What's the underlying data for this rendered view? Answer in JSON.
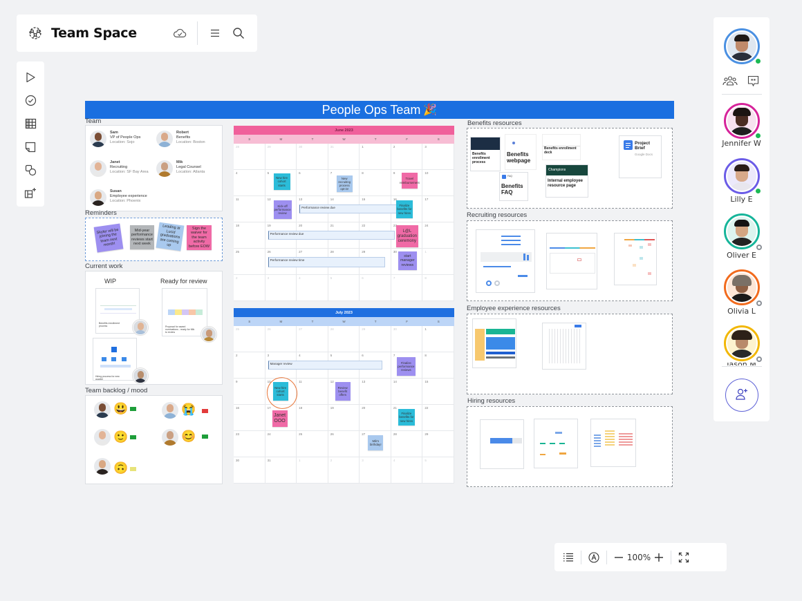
{
  "topbar": {
    "space_icon": "team-space-icon",
    "title": "Team Space",
    "icons": [
      "cloud-saved-icon",
      "menu-icon",
      "search-icon"
    ]
  },
  "left_toolbar": {
    "tools": [
      {
        "name": "select-tool",
        "icon": "cursor-icon"
      },
      {
        "name": "task-tool",
        "icon": "check-circle-icon"
      },
      {
        "name": "table-tool",
        "icon": "table-icon"
      },
      {
        "name": "sticky-note-tool",
        "icon": "sticky-note-icon"
      },
      {
        "name": "shapes-tool",
        "icon": "shapes-icon"
      },
      {
        "name": "add-template-tool",
        "icon": "add-frame-icon"
      }
    ]
  },
  "collaborators": {
    "current_user": {
      "ring_color": "#4a90e2",
      "status": "online"
    },
    "icons": [
      "team-icon",
      "comments-icon"
    ],
    "people": [
      {
        "name": "Jennifer W",
        "ring_color": "#d6239a",
        "status": "online"
      },
      {
        "name": "Lilly E",
        "ring_color": "#6b5ce7",
        "status": "online"
      },
      {
        "name": "Oliver E",
        "ring_color": "#16b59a",
        "status": "away"
      },
      {
        "name": "Olivia L",
        "ring_color": "#f26b1d",
        "status": "away"
      },
      {
        "name": "Jason M",
        "ring_color": "#f2b705",
        "status": "away"
      }
    ],
    "add_user_icon": "add-user-icon"
  },
  "zoom_bar": {
    "zoom_level": "100%",
    "icons": [
      "outline-icon",
      "accessibility-icon",
      "zoom-out-icon",
      "zoom-in-icon",
      "fullscreen-icon"
    ]
  },
  "board": {
    "title": "People Ops Team",
    "title_emoji": "🎉",
    "team": {
      "label": "Team",
      "members": [
        {
          "name": "Sam",
          "role": "VP of People Ops",
          "location": "Location: Sojo"
        },
        {
          "name": "Robert",
          "role": "Benefits",
          "location": "Location: Boston"
        },
        {
          "name": "Janet",
          "role": "Recruiting",
          "location": "Location: SF Bay Area"
        },
        {
          "name": "Mik",
          "role": "Legal Counsel",
          "location": "Location: Atlanta"
        },
        {
          "name": "Susan",
          "role": "Employee experience",
          "location": "Location: Phoenix"
        }
      ]
    },
    "reminders": {
      "label": "Reminders",
      "notes": [
        {
          "text": "Skyler will be joining the team next month!",
          "color": "#9d8ff0"
        },
        {
          "text": "Mid-year performance reviews start next week",
          "color": "#b3b6b9"
        },
        {
          "text": "Leading at Lucid graduations are coming up",
          "color": "#a9c9ee"
        },
        {
          "text": "Sign the waiver for the team activity before EOW",
          "color": "#f06aa6"
        }
      ]
    },
    "current_work": {
      "label": "Current work",
      "columns": [
        "WIP",
        "Ready for review"
      ],
      "items": [
        {
          "caption": "Benefits enrollment process",
          "column": "WIP"
        },
        {
          "caption": "Hiring process for new quarter",
          "column": "WIP"
        },
        {
          "caption": "Proposal for award nominations - ready for Mik to review",
          "column": "Ready for review"
        }
      ]
    },
    "mood": {
      "label": "Team backlog / mood",
      "entries": [
        {
          "emoji": "😃",
          "backlog": "#1e9e3a"
        },
        {
          "emoji": "😭",
          "backlog": "#e23b3b"
        },
        {
          "emoji": "🙂",
          "backlog": "#1e9e3a"
        },
        {
          "emoji": "😊",
          "backlog": "#1e9e3a"
        },
        {
          "emoji": "🙃",
          "backlog": "#e7e37a"
        }
      ]
    },
    "calendars": [
      {
        "month": "June 2023",
        "header_color": "#f0609b",
        "days_color": "#f7bdd4",
        "weekdays": [
          "S",
          "M",
          "T",
          "W",
          "T",
          "F",
          "S"
        ],
        "dates": [
          "28",
          "29",
          "30",
          "31",
          "1",
          "2",
          "3",
          "4",
          "5",
          "6",
          "7",
          "8",
          "9",
          "10",
          "11",
          "12",
          "13",
          "14",
          "15",
          "16",
          "17",
          "18",
          "19",
          "20",
          "21",
          "22",
          "23",
          "24",
          "25",
          "26",
          "27",
          "28",
          "29",
          "30",
          "1",
          "2",
          "3",
          "4",
          "5",
          "6",
          "7",
          "8"
        ],
        "events": [
          {
            "title": "Performance review due"
          },
          {
            "title": "Performance review due"
          },
          {
            "title": "Performance review time"
          }
        ],
        "stickies": [
          {
            "text": "New hire cohort starts",
            "color": "#2bbcd9"
          },
          {
            "text": "New recruiting process opt-in!",
            "color": "#a9c9ee"
          },
          {
            "text": "Travel reimbursement",
            "color": "#f06aa6"
          },
          {
            "text": "Kick-off performance review",
            "color": "#9d8ff0"
          },
          {
            "text": "Finalize benefits for new hires",
            "color": "#2bbcd9"
          },
          {
            "text": "L@L graduation ceremony",
            "color": "#f06aa6"
          },
          {
            "text": "start manager reviews",
            "color": "#9d8ff0"
          }
        ]
      },
      {
        "month": "July 2023",
        "header_color": "#1f6fe0",
        "days_color": "#bcd5f7",
        "weekdays": [
          "S",
          "M",
          "T",
          "W",
          "T",
          "F",
          "S"
        ],
        "dates": [
          "25",
          "26",
          "27",
          "28",
          "29",
          "30",
          "1",
          "2",
          "3",
          "4",
          "5",
          "6",
          "7",
          "8",
          "9",
          "10",
          "11",
          "12",
          "13",
          "14",
          "15",
          "16",
          "17",
          "18",
          "19",
          "20",
          "21",
          "22",
          "23",
          "24",
          "25",
          "26",
          "27",
          "28",
          "29",
          "30",
          "31",
          "1",
          "2",
          "3",
          "4",
          "5"
        ],
        "events": [
          {
            "title": "Manager review"
          }
        ],
        "stickies": [
          {
            "text": "Finalize performance reviews",
            "color": "#9d8ff0"
          },
          {
            "text": "New hire cohort starts",
            "color": "#2bbcd9"
          },
          {
            "text": "Review benefit offers",
            "color": "#9d8ff0"
          },
          {
            "text": "Janet OOO",
            "color": "#f06aa6"
          },
          {
            "text": "Finalize benefits for new hires",
            "color": "#2bbcd9"
          },
          {
            "text": "Mik's birthday!",
            "color": "#a9c9ee"
          }
        ]
      }
    ],
    "resources": {
      "benefits": {
        "label": "Benefits resources",
        "cards": [
          "Benefits enrollment process",
          "Benefits webpage",
          "Benefits enrollment deck",
          "Benefits FAQ",
          "Internal employee resource page",
          "Project Brief"
        ],
        "champions_label": "Champions",
        "faq_tag": "FAQ",
        "project_brief_source": "Google Docs"
      },
      "recruiting": {
        "label": "Recruiting resources"
      },
      "employee_experience": {
        "label": "Employee experience resources"
      },
      "hiring": {
        "label": "Hiring resources"
      }
    }
  }
}
